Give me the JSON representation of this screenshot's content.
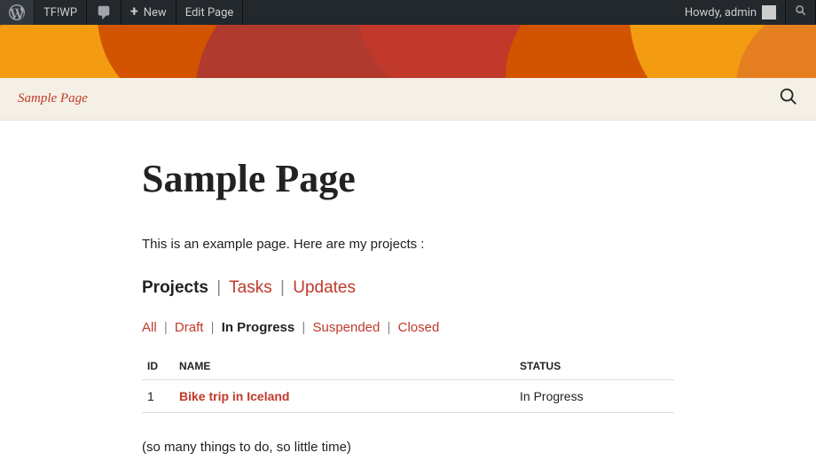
{
  "adminbar": {
    "site_name": "TF!WP",
    "new_label": "New",
    "edit_label": "Edit Page",
    "greeting": "Howdy, admin"
  },
  "nav": {
    "link_label": "Sample Page"
  },
  "page": {
    "title": "Sample Page",
    "intro": "This is an example page. Here are my projects :",
    "outro": "(so many things to do, so little time)"
  },
  "tabs": {
    "active": "Projects",
    "others": {
      "tasks": "Tasks",
      "updates": "Updates"
    },
    "sep": "|"
  },
  "filters": {
    "all": "All",
    "draft": "Draft",
    "in_progress": "In Progress",
    "suspended": "Suspended",
    "closed": "Closed",
    "sep": "|"
  },
  "table": {
    "headers": {
      "id": "ID",
      "name": "NAME",
      "status": "STATUS"
    },
    "rows": [
      {
        "id": "1",
        "name": "Bike trip in Iceland",
        "status": "In Progress"
      }
    ]
  }
}
